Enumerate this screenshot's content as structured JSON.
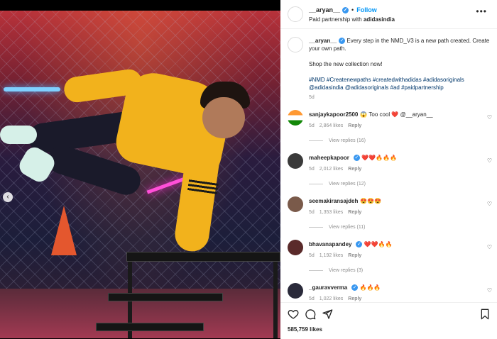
{
  "post": {
    "username": "__aryan__",
    "follow_label": "Follow",
    "partnership_prefix": "Paid partnership with",
    "partner": "adidasindia",
    "more_label": "•••"
  },
  "caption": {
    "username": "__aryan__",
    "text": "Every step in the NMD_V3 is a new path created. Create your own path.",
    "line2": "Shop the new collection now!",
    "tags": "#NMD #Createnewpaths #createdwithadidas #adidasoriginals @adidasindia @adidasoriginals #ad #paidpartnership",
    "time": "5d"
  },
  "comments": [
    {
      "username": "sanjaykapoor2500",
      "text": "😱 Too cool ❤️ @__aryan__",
      "time": "5d",
      "likes": "2,864 likes",
      "reply": "Reply",
      "view_replies": "View replies (16)",
      "verified": false,
      "avatar_color": "#ff9933"
    },
    {
      "username": "maheepkapoor",
      "text": "❤️❤️🔥🔥🔥",
      "time": "5d",
      "likes": "2,012 likes",
      "reply": "Reply",
      "view_replies": "View replies (12)",
      "verified": true,
      "avatar_color": "#3a3a3a"
    },
    {
      "username": "seemakiransajdeh",
      "text": "😍😍😍",
      "time": "5d",
      "likes": "1,353 likes",
      "reply": "Reply",
      "view_replies": "View replies (11)",
      "verified": false,
      "avatar_color": "#7a5a4a"
    },
    {
      "username": "bhavanapandey",
      "text": "❤️❤️🔥🔥",
      "time": "5d",
      "likes": "1,192 likes",
      "reply": "Reply",
      "view_replies": "View replies (3)",
      "verified": true,
      "avatar_color": "#5a2a2a"
    },
    {
      "username": "_gauravverma",
      "text": "🔥🔥🔥",
      "time": "5d",
      "likes": "1,022 likes",
      "reply": "Reply",
      "view_replies": "",
      "verified": true,
      "avatar_color": "#2a2a3a"
    }
  ],
  "stats": {
    "likes": "585,759 likes"
  },
  "icons": {
    "like": "heart-icon",
    "comment": "comment-icon",
    "share": "share-icon",
    "save": "bookmark-icon",
    "carousel_prev": "chevron-left-icon",
    "comment_like": "heart-icon",
    "verified": "verified-badge-icon"
  },
  "colors": {
    "link": "#0095f6",
    "hashtag": "#00376b",
    "verified": "#3897f0",
    "secondary_text": "#8e8e8e"
  }
}
